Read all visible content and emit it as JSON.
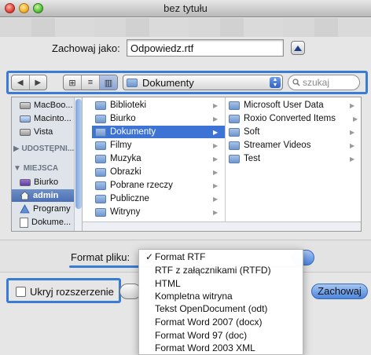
{
  "window": {
    "title": "bez tytułu"
  },
  "saveas": {
    "label": "Zachowaj jako:",
    "value": "Odpowiedz.rtf"
  },
  "toolbar": {
    "back_icon": "◀",
    "forward_icon": "▶",
    "view_icon_glyph": "⊞",
    "view_list_glyph": "≡",
    "view_column_glyph": "▥",
    "location": "Dokumenty",
    "search_placeholder": "szukaj"
  },
  "sidebar": {
    "devices": [
      {
        "label": "MacBoo...",
        "icon": "laptop-icon"
      },
      {
        "label": "Macinto...",
        "icon": "hard-drive-icon"
      },
      {
        "label": "Vista",
        "icon": "disk-icon"
      }
    ],
    "shared_header": "UDOSTĘPNI...",
    "places_header": "MIEJSCA",
    "places": [
      {
        "label": "Biurko",
        "icon": "desktop-icon"
      },
      {
        "label": "admin",
        "icon": "home-icon"
      },
      {
        "label": "Programy",
        "icon": "applications-icon"
      },
      {
        "label": "Dokume...",
        "icon": "document-icon"
      }
    ]
  },
  "columns": {
    "first": [
      "Biblioteki",
      "Biurko",
      "Dokumenty",
      "Filmy",
      "Muzyka",
      "Obrazki",
      "Pobrane rzeczy",
      "Publiczne",
      "Witryny"
    ],
    "first_selected": "Dokumenty",
    "second": [
      "Microsoft User Data",
      "Roxio Converted Items",
      "Soft",
      "Streamer Videos",
      "Test"
    ]
  },
  "format": {
    "label": "Format pliku:"
  },
  "menu": {
    "checkmark": "✓",
    "items": [
      "Format RTF",
      "RTF z załącznikami (RTFD)",
      "HTML",
      "Kompletna witryna",
      "Tekst OpenDocument (odt)",
      "Format Word 2007 (docx)",
      "Format Word 97 (doc)",
      "Format Word 2003 XML"
    ]
  },
  "buttons": {
    "hide_extension": "Ukryj rozszerzenie",
    "save": "Zachowaj"
  },
  "colors": {
    "accent": "#3a7bd5",
    "selection": "#3d73d4"
  }
}
